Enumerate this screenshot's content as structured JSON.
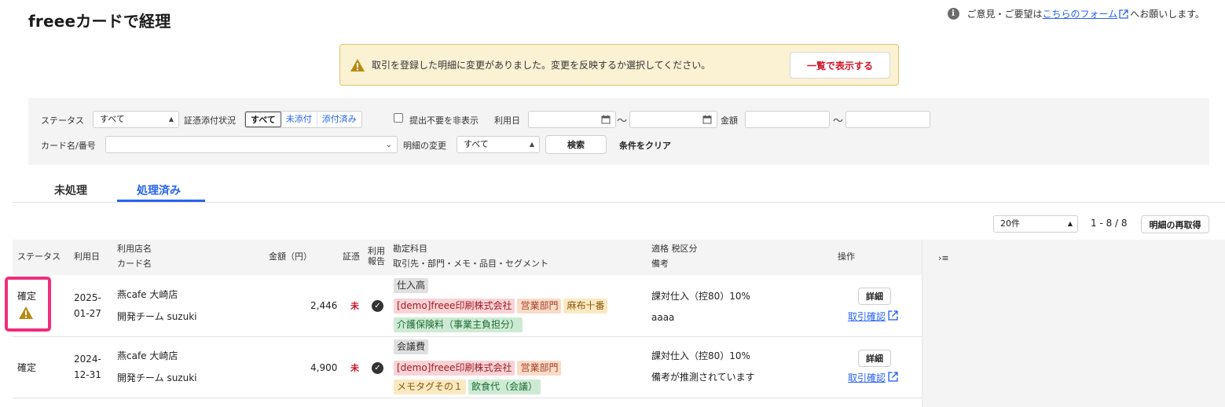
{
  "page": {
    "title": "freeeカードで経理"
  },
  "feedback": {
    "prefix": "ご意見・ご要望は",
    "link": "こちらのフォーム",
    "suffix": "へお願いします。"
  },
  "alert": {
    "message": "取引を登録した明細に変更がありました。変更を反映するか選択してください。",
    "button": "一覧で表示する"
  },
  "filter": {
    "status_label": "ステータス",
    "status_value": "すべて",
    "attach_label": "証憑添付状況",
    "attach_options": [
      "すべて",
      "未添付",
      "添付済み"
    ],
    "hide_unneeded_label": "提出不要を非表示",
    "date_label": "利用日",
    "amount_label": "金額",
    "tilde": "〜",
    "card_label": "カード名/番号",
    "change_label": "明細の変更",
    "change_value": "すべて",
    "search_button": "検索",
    "clear_button": "条件をクリア"
  },
  "tabs": [
    "未処理",
    "処理済み"
  ],
  "pagination": {
    "per_page": "20件",
    "range": "1 - 8 / 8",
    "refetch_button": "明細の再取得"
  },
  "table": {
    "headers": {
      "status": "ステータス",
      "date": "利用日",
      "store": "利用店名",
      "card": "カード名",
      "amount": "金額（円）",
      "evidence": "証憑",
      "report_1": "利用",
      "report_2": "報告",
      "account": "勘定科目",
      "details": "取引先・部門・メモ・品目・セグメント",
      "qualified_tax": "適格  税区分",
      "memo": "備考",
      "actions": "操作"
    },
    "rows": [
      {
        "status": "確定",
        "date_1": "2025-",
        "date_2": "01-27",
        "store": "燕cafe 大崎店",
        "card": "開発チーム suzuki",
        "amount": "2,446",
        "evidence": "未",
        "account": "仕入高",
        "tags_line1": [
          "[demo]freee印刷株式会社",
          "営業部門",
          "麻布十番"
        ],
        "tags_line2": [
          "介護保険料（事業主負担分）"
        ],
        "tax": "課対仕入（控80）10%",
        "memo": "aaaa",
        "detail_button": "詳細",
        "confirm_link": "取引確認"
      },
      {
        "status": "確定",
        "date_1": "2024-",
        "date_2": "12-31",
        "store": "燕cafe 大崎店",
        "card": "開発チーム suzuki",
        "amount": "4,900",
        "evidence": "未",
        "account": "会議費",
        "tags_line1": [
          "[demo]freee印刷株式会社",
          "営業部門"
        ],
        "tags_line2": [
          "メモタグその１",
          "飲食代（会議）"
        ],
        "tax": "課対仕入（控80）10%",
        "memo": "備考が推測されています",
        "detail_button": "詳細",
        "confirm_link": "取引確認"
      }
    ]
  },
  "side_panel": {
    "toggle_icon": "›≡"
  },
  "colors": {
    "accent": "#2864f0",
    "danger": "#d2142a",
    "warning_bg": "#fbf1d3",
    "highlight": "#ee2f7a"
  }
}
